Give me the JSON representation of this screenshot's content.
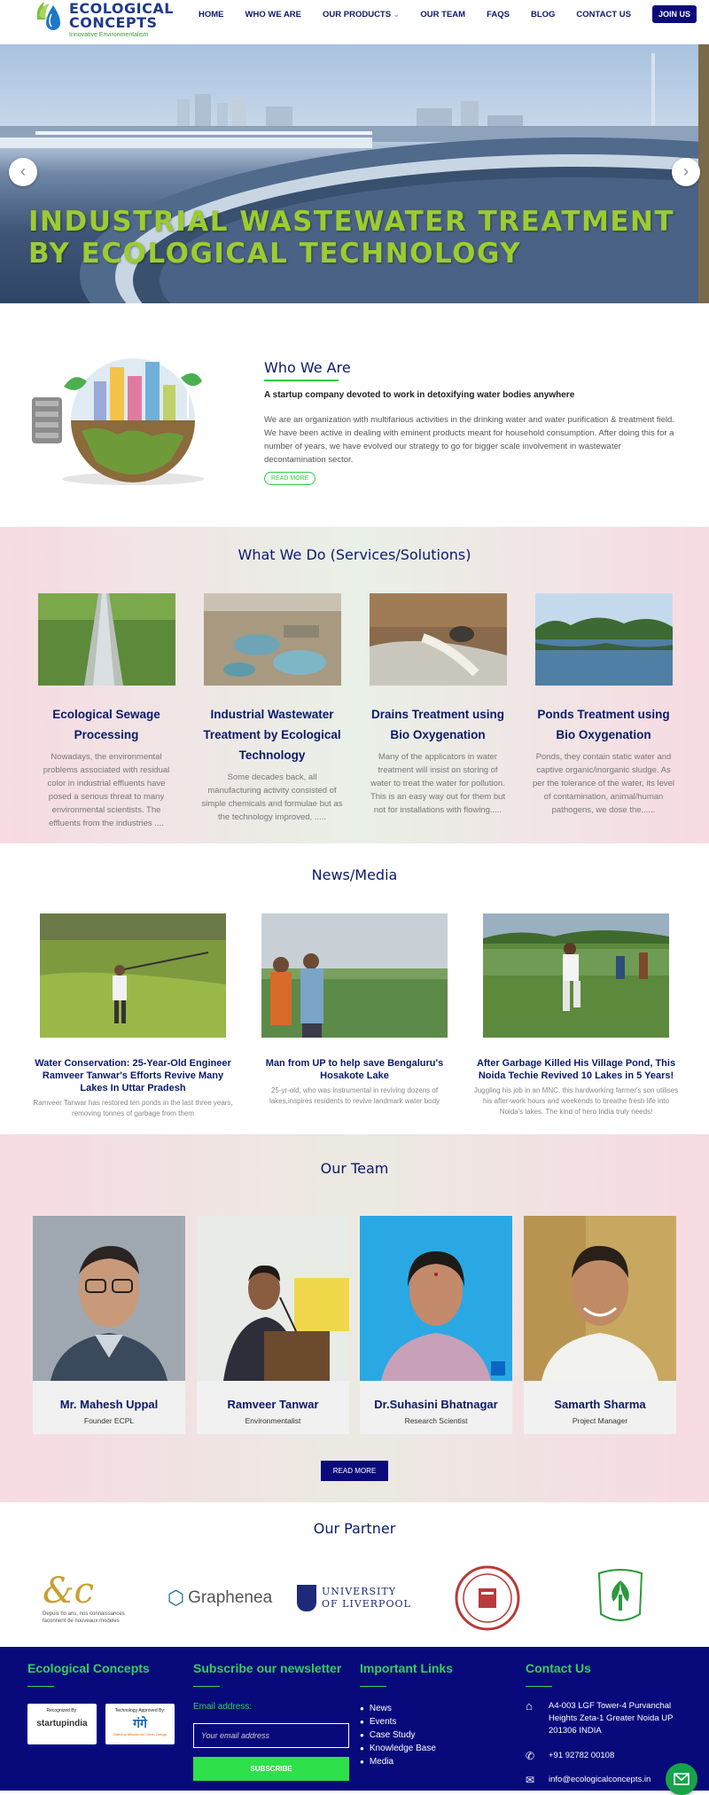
{
  "header": {
    "logo_title_1": "ECOLOGICAL",
    "logo_title_2": "CONCEPTS",
    "logo_tagline": "Innovative Environmentalism",
    "nav": [
      "HOME",
      "WHO WE ARE",
      "OUR PRODUCTS",
      "OUR TEAM",
      "FAQS",
      "BLOG",
      "CONTACT US"
    ],
    "join_label": "JOIN US",
    "products_dropdown_icon": "chevron-down-icon"
  },
  "hero": {
    "line1": "INDUSTRIAL WASTEWATER TREATMENT",
    "line2": "BY ECOLOGICAL TECHNOLOGY",
    "prev_icon": "chevron-left-icon",
    "next_icon": "chevron-right-icon",
    "text_color": "#9ccc30"
  },
  "who": {
    "title": "Who We Are",
    "subtitle": "A startup company devoted to work in detoxifying water bodies anywhere",
    "text": "We are an organization with multifarious activities in the drinking water and water purification & treatment field. We have been active in dealing with eminent products meant for household consumption. After doing this for a number of years, we have evolved our strategy to go for bigger scale involvement in wastewater decontamination sector.",
    "button": "READ MORE"
  },
  "services": {
    "title": "What We Do (Services/Solutions)",
    "items": [
      {
        "title": "Ecological Sewage Processing",
        "text": "Nowadays, the environmental problems associated with residual color in industrial effluents have posed a serious threat to many environmental scientists. The effluents from the industries ...."
      },
      {
        "title": "Industrial Wastewater Treatment by Ecological Technology",
        "text": "Some decades back, all manufacturing activity consisted of simple chemicals and formulae but as the technology improved, ....."
      },
      {
        "title": "Drains Treatment using Bio Oxygenation",
        "text": "Many of the applicators in water treatment will insist on storing of water to treat the water for pollution. This is an easy way out for them but not for installations with flowing....."
      },
      {
        "title": "Ponds Treatment using Bio Oxygenation",
        "text": "Ponds, they contain static water and captive organic/inorganic sludge. As per the tolerance of the water, its level of contamination, animal/human pathogens, we dose the......"
      }
    ]
  },
  "news": {
    "title": "News/Media",
    "items": [
      {
        "title": "Water Conservation: 25-Year-Old Engineer Ramveer Tanwar's Efforts Revive Many Lakes In Uttar Pradesh",
        "text": "Ramveer Tanwar has restored ten ponds in the last three years, removing tonnes of garbage from them"
      },
      {
        "title": "Man from UP to help save Bengaluru's Hosakote Lake",
        "text": "25-yr-old, who was instrumental in reviving dozens of lakes,inspires residents to revive landmark water body"
      },
      {
        "title": "After Garbage Killed His Village Pond, This Noida Techie Revived 10 Lakes in 5 Years!",
        "text": "Juggling his job in an MNC, this hardworking farmer's son utilises his after-work hours and weekends to breathe fresh life into Noida's lakes. The kind of hero India truly needs!"
      }
    ]
  },
  "team": {
    "title": "Our Team",
    "members": [
      {
        "name": "Mr. Mahesh Uppal",
        "role": "Founder ECPL"
      },
      {
        "name": "Ramveer Tanwar",
        "role": "Environmentalist"
      },
      {
        "name": "Dr.Suhasini Bhatnagar",
        "role": "Research Scientist"
      },
      {
        "name": "Samarth Sharma",
        "role": "Project Manager"
      }
    ],
    "button": "READ MORE"
  },
  "partners": {
    "title": "Our Partner",
    "items": [
      {
        "name": "&c",
        "sub": "Depuis ho ans, nos connaissances faconnent de nouveaux modeles"
      },
      {
        "name": "Graphenea"
      },
      {
        "name": "UNIVERSITY OF LIVERPOOL"
      },
      {
        "name": "university-seal"
      },
      {
        "name": "forest-department-emblem"
      }
    ]
  },
  "footer": {
    "col1_title": "Ecological Concepts",
    "badge1_top": "Recognized By:",
    "badge1_name": "startupindia",
    "badge2_top": "Technology Approved By:",
    "badge2_name": "गंगे",
    "badge2_sub": "National Mission for Clean Ganga",
    "col2_title": "Subscribe our newsletter",
    "email_label": "Email address:",
    "email_placeholder": "Your email address",
    "subscribe": "SUBSCRIBE",
    "col3_title": "Important Links",
    "links": [
      "News",
      "Events",
      "Case Study",
      "Knowledge Base",
      "Media"
    ],
    "col4_title": "Contact Us",
    "address": "A4-003 LGF Tower-4 Purvanchal Heights Zeta-1 Greater Noida UP 201306 INDIA",
    "phone": "+91 92782 00108",
    "email": "info@ecologicalconcepts.in",
    "accent": "#35d05a",
    "bg": "#080a7c"
  }
}
